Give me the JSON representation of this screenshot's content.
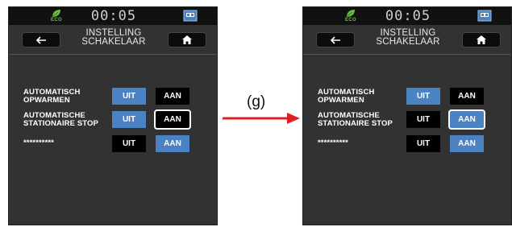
{
  "transition_label": "(g)",
  "colors": {
    "accent_blue": "#4a82c3",
    "arrow_red": "#e02020",
    "eco_green": "#6abf3f"
  },
  "screens": [
    {
      "status": {
        "eco_label": "ECO",
        "clock": "00:05",
        "battery_icon": "battery-icon"
      },
      "back_icon": "arrow-left-icon",
      "home_icon": "home-icon",
      "title_line1": "INSTELLING",
      "title_line2": "SCHAKELAAR",
      "rows": [
        {
          "label_line1": "AUTOMATISCH",
          "label_line2": "OPWARMEN",
          "off_label": "UIT",
          "on_label": "AAN",
          "active": "off",
          "selected": ""
        },
        {
          "label_line1": "AUTOMATISCHE",
          "label_line2": "STATIONAIRE STOP",
          "off_label": "UIT",
          "on_label": "AAN",
          "active": "off",
          "selected": "on"
        },
        {
          "label_line1": "**********",
          "label_line2": "",
          "off_label": "UIT",
          "on_label": "AAN",
          "active": "on",
          "selected": ""
        }
      ]
    },
    {
      "status": {
        "eco_label": "ECO",
        "clock": "00:05",
        "battery_icon": "battery-icon"
      },
      "back_icon": "arrow-left-icon",
      "home_icon": "home-icon",
      "title_line1": "INSTELLING",
      "title_line2": "SCHAKELAAR",
      "rows": [
        {
          "label_line1": "AUTOMATISCH",
          "label_line2": "OPWARMEN",
          "off_label": "UIT",
          "on_label": "AAN",
          "active": "off",
          "selected": ""
        },
        {
          "label_line1": "AUTOMATISCHE",
          "label_line2": "STATIONAIRE STOP",
          "off_label": "UIT",
          "on_label": "AAN",
          "active": "on",
          "selected": "on"
        },
        {
          "label_line1": "**********",
          "label_line2": "",
          "off_label": "UIT",
          "on_label": "AAN",
          "active": "on",
          "selected": ""
        }
      ]
    }
  ]
}
